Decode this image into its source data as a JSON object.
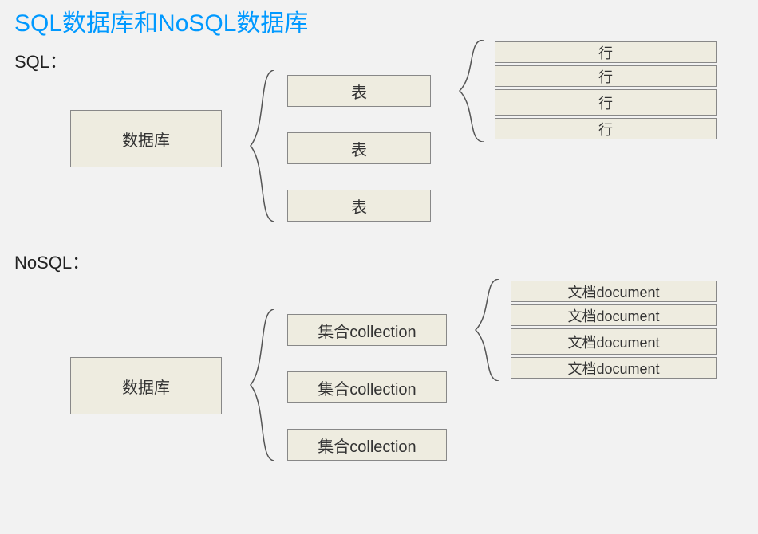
{
  "title": "SQL数据库和NoSQL数据库",
  "sql": {
    "label": "SQL：",
    "database": "数据库",
    "tables": [
      "表",
      "表",
      "表"
    ],
    "rows": [
      "行",
      "行",
      "行",
      "行"
    ]
  },
  "nosql": {
    "label": "NoSQL：",
    "database": "数据库",
    "collections": [
      "集合collection",
      "集合collection",
      "集合collection"
    ],
    "documents": [
      "文档document",
      "文档document",
      "文档document",
      "文档document"
    ]
  }
}
